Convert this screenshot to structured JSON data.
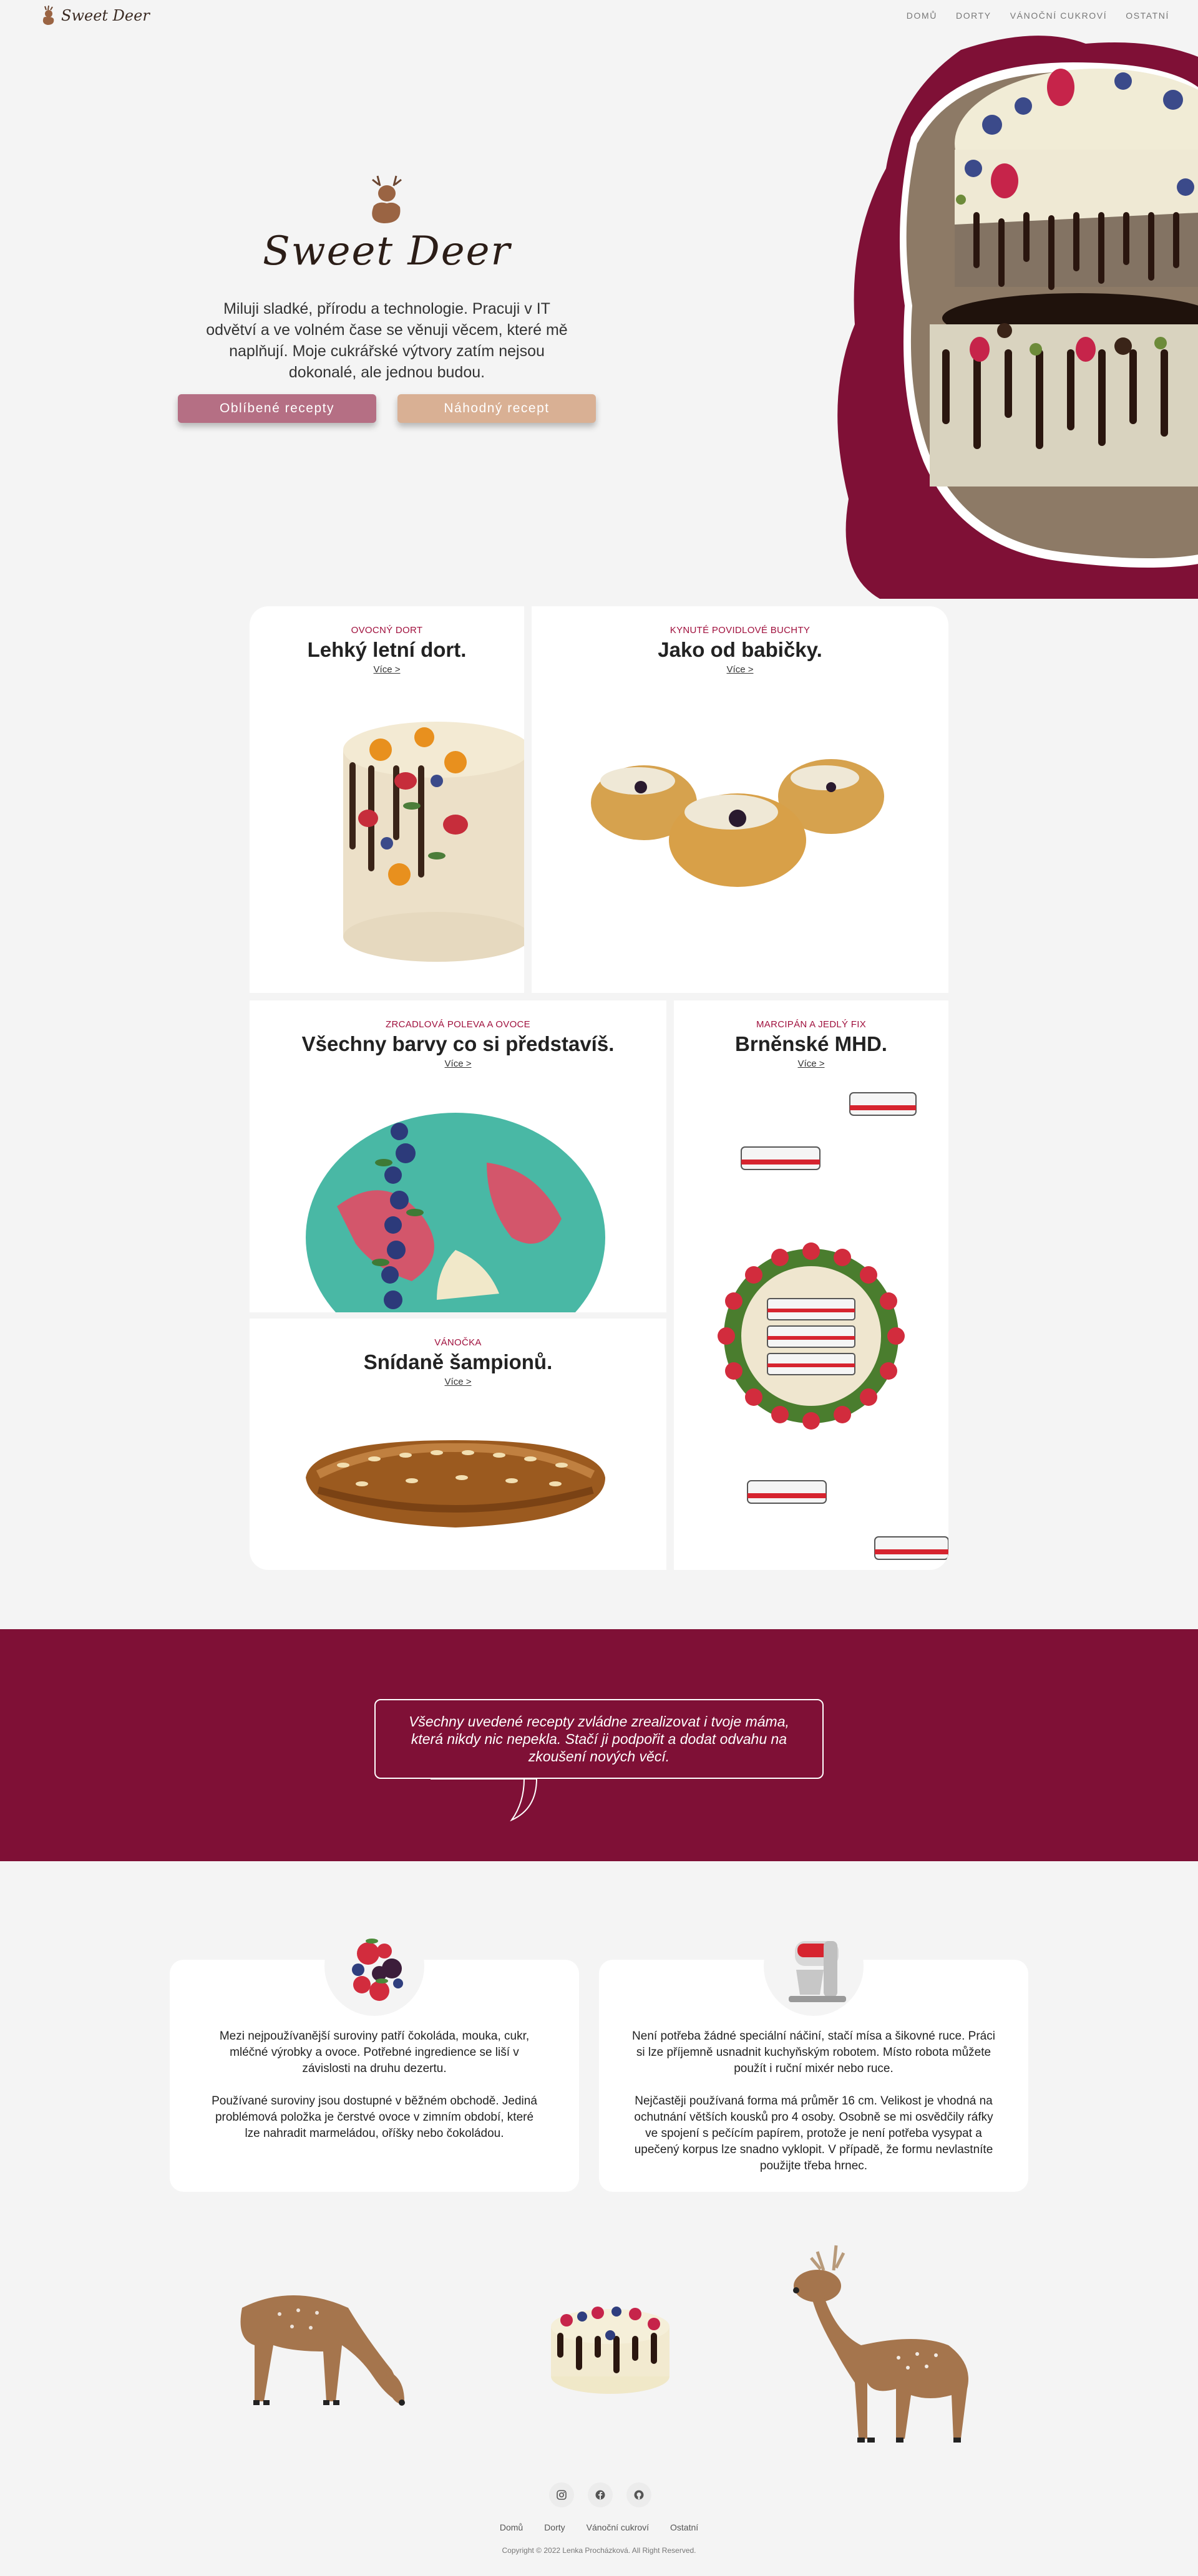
{
  "nav": {
    "brand": "Sweet Deer",
    "items": [
      "DOMŮ",
      "DORTY",
      "VÁNOČNÍ CUKROVÍ",
      "OSTATNÍ"
    ]
  },
  "hero": {
    "logo_text": "Sweet Deer",
    "description": "Miluji sladké, přírodu a technologie. Pracuji v IT odvětví a ve volném čase se věnuji věcem, které mě naplňují. Moje cukrářské výtvory zatím nejsou dokonalé, ale jednou budou.",
    "btn_favorite": "Oblíbené recepty",
    "btn_random": "Náhodný recept"
  },
  "cards": [
    {
      "category": "OVOCNÝ DORT",
      "title": "Lehký letní dort.",
      "more": "Více >"
    },
    {
      "category": "KYNUTÉ POVIDLOVÉ BUCHTY",
      "title": "Jako od babičky.",
      "more": "Více >"
    },
    {
      "category": "ZRCADLOVÁ POLEVA A OVOCE",
      "title": "Všechny barvy co si představíš.",
      "more": "Více >"
    },
    {
      "category": "MARCIPÁN A JEDLÝ FIX",
      "title": "Brněnské MHD.",
      "more": "Více >"
    },
    {
      "category": "VÁNOČKA",
      "title": "Snídaně šampionů.",
      "more": "Více >"
    }
  ],
  "quote": "Všechny uvedené recepty zvládne zrealizovat i tvoje máma, která nikdy nic nepekla. Stačí ji podpořit a dodat odvahu na zkoušení nových věcí.",
  "info": {
    "ingredients_p1": "Mezi nejpoužívanější suroviny patří čokoláda, mouka, cukr, mléčné výrobky a ovoce. Potřebné ingredience se liší v závislosti na druhu dezertu.",
    "ingredients_p2": "Používané suroviny jsou dostupné v běžném obchodě. Jediná problémová položka je čerstvé ovoce v zimním období, které lze nahradit marmeládou, oříšky nebo čokoládou.",
    "tools_p1": "Není potřeba žádné speciální náčiní, stačí mísa a šikovné ruce. Práci si lze příjemně usnadnit kuchyňským robotem. Místo robota můžete použít i ruční mixér nebo ruce.",
    "tools_p2": "Nejčastěji používaná forma má průměr 16 cm. Velikost je vhodná na ochutnání větších kousků pro 4 osoby. Osobně se mi osvědčily ráfky ve spojení s pečícím papírem, protože je není potřeba vysypat a upečený korpus lze snadno vyklopit. V případě, že formu nevlastníte použijte třeba hrnec."
  },
  "footer": {
    "links": [
      "Domů",
      "Dorty",
      "Vánoční cukroví",
      "Ostatní"
    ],
    "copyright": "Copyright © 2022 Lenka Procházková. All Right Reserved.",
    "icons": [
      "instagram-icon",
      "facebook-icon",
      "github-icon"
    ]
  },
  "colors": {
    "accent": "#7f1036",
    "primary_button": "#b56f84",
    "secondary_button": "#d9b094",
    "category": "#a0103d"
  }
}
